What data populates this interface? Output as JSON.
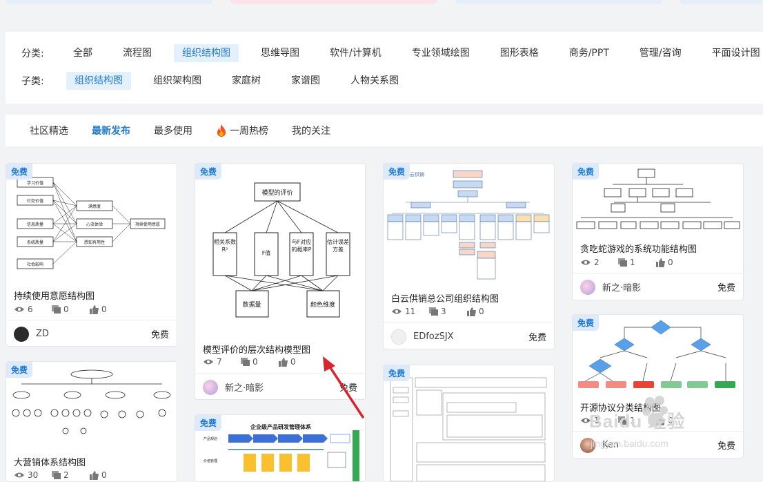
{
  "categories": {
    "label": "分类:",
    "items": [
      "全部",
      "流程图",
      "组织结构图",
      "思维导图",
      "软件/计算机",
      "专业领域绘图",
      "图形表格",
      "商务/PPT",
      "管理/咨询",
      "平面设计图"
    ],
    "active_index": 2
  },
  "subcategories": {
    "label": "子类:",
    "items": [
      "组织结构图",
      "组织架构图",
      "家庭树",
      "家谱图",
      "人物关系图"
    ],
    "active_index": 0
  },
  "tabs": {
    "items": [
      "社区精选",
      "最新发布",
      "最多使用",
      "一周热榜",
      "我的关注"
    ],
    "active_index": 1
  },
  "free_badge": "免费",
  "cards": [
    {
      "title": "持续使用意愿结构图",
      "views": "6",
      "comments": "0",
      "likes": "0",
      "author": "ZD",
      "price": "免费",
      "thumb_labels": [
        "学习价值",
        "社交价值",
        "信息质量",
        "系统质量",
        "社会影响",
        "满意度",
        "心流体验",
        "感知有用性",
        "持续使用意愿"
      ]
    },
    {
      "title": "模型评价的层次结构模型图",
      "views": "7",
      "comments": "0",
      "likes": "0",
      "author": "新之·暗影",
      "price": "免费",
      "thumb_labels": [
        "模型的评价",
        "相关系数R²",
        "F值",
        "与F对应的概率P",
        "估计误差方差",
        "数据量",
        "颜色维度"
      ]
    },
    {
      "title": "白云供销总公司组织结构图",
      "views": "11",
      "comments": "3",
      "likes": "0",
      "author": "EDfozSJX",
      "price": "免费",
      "thumb_labels": [
        "云供销"
      ]
    },
    {
      "title": "贪吃蛇游戏的系统功能结构图",
      "views": "2",
      "comments": "1",
      "likes": "0",
      "author": "新之·暗影",
      "price": "免费",
      "thumb_labels": []
    },
    {
      "title": "开源协议分类结构图",
      "views": "1",
      "comments": "1",
      "likes": "0",
      "author": "Ken",
      "price": "免费",
      "thumb_labels": []
    },
    {
      "title": "大营销体系结构图",
      "views": "30",
      "comments": "2",
      "likes": "0",
      "thumb_labels": []
    },
    {
      "title": "",
      "thumb_labels": [
        "企业级产品研发管理体系",
        "产品规划",
        "价值管理"
      ]
    },
    {
      "title": "",
      "thumb_labels": []
    }
  ],
  "watermark_text": "Baidu 经验",
  "watermark_url": "jingyan.baidu.com",
  "colors": {
    "accent": "#1f7ad6",
    "active_bg": "#e4f0fc",
    "badge_bg": "#dceafb",
    "arrow": "#d9232d"
  }
}
